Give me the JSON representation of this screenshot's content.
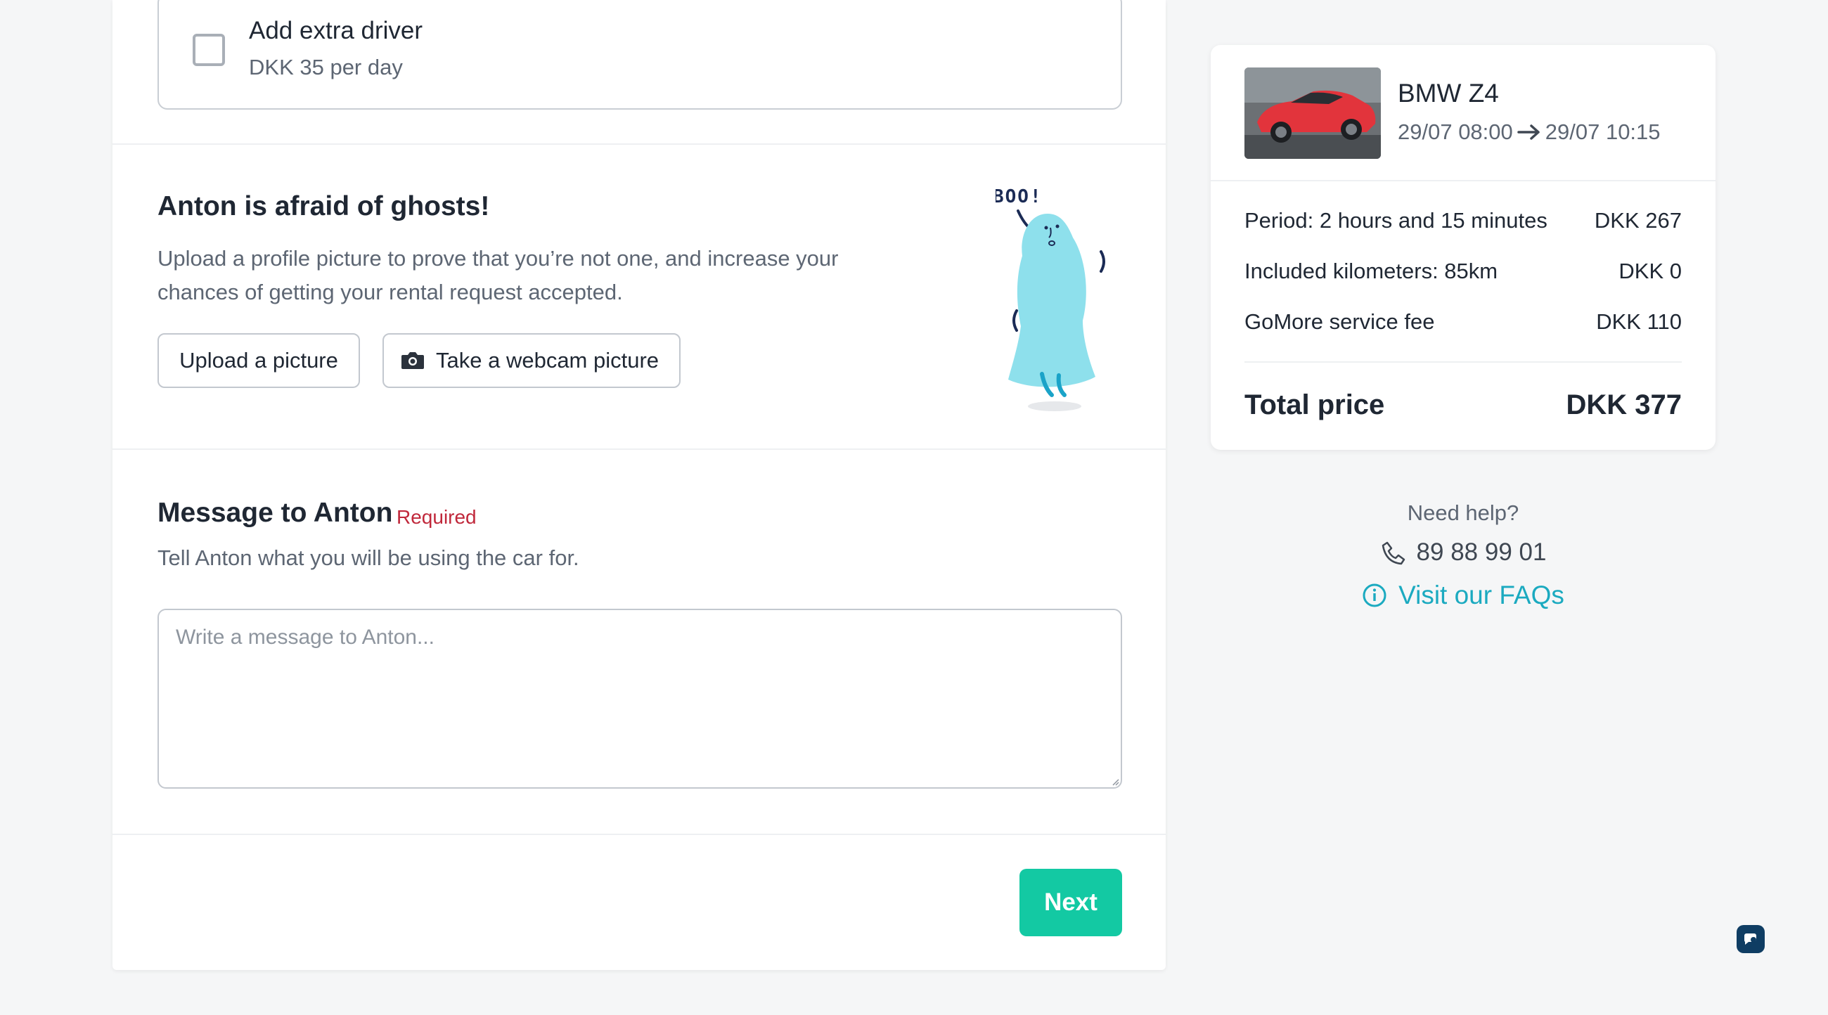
{
  "extra_driver": {
    "title": "Add extra driver",
    "subtitle": "DKK 35 per day",
    "checked": false
  },
  "ghost_section": {
    "title": "Anton is afraid of ghosts!",
    "description": "Upload a profile picture to prove that you’re not one, and increase your chances of getting your rental request accepted.",
    "upload_label": "Upload a picture",
    "webcam_label": "Take a webcam picture",
    "illustration_text": "BOO!"
  },
  "message_section": {
    "title": "Message to Anton",
    "required_label": "Required",
    "subtitle": "Tell Anton what you will be using the car for.",
    "placeholder": "Write a message to Anton...",
    "value": ""
  },
  "next_label": "Next",
  "summary": {
    "car_name": "BMW Z4",
    "start": "29/07 08:00",
    "end": "29/07 10:15",
    "lines": [
      {
        "label": "Period: 2 hours and 15 minutes",
        "amount": "DKK 267"
      },
      {
        "label": "Included kilometers: 85km",
        "amount": "DKK 0"
      },
      {
        "label": "GoMore service fee",
        "amount": "DKK 110"
      }
    ],
    "total_label": "Total price",
    "total_amount": "DKK 377"
  },
  "help": {
    "title": "Need help?",
    "phone": "89 88 99 01",
    "faq_label": "Visit our FAQs"
  },
  "colors": {
    "accent": "#13c9a3",
    "link": "#1baac0",
    "required": "#c0283b",
    "ghost": "#8ee0ec"
  }
}
